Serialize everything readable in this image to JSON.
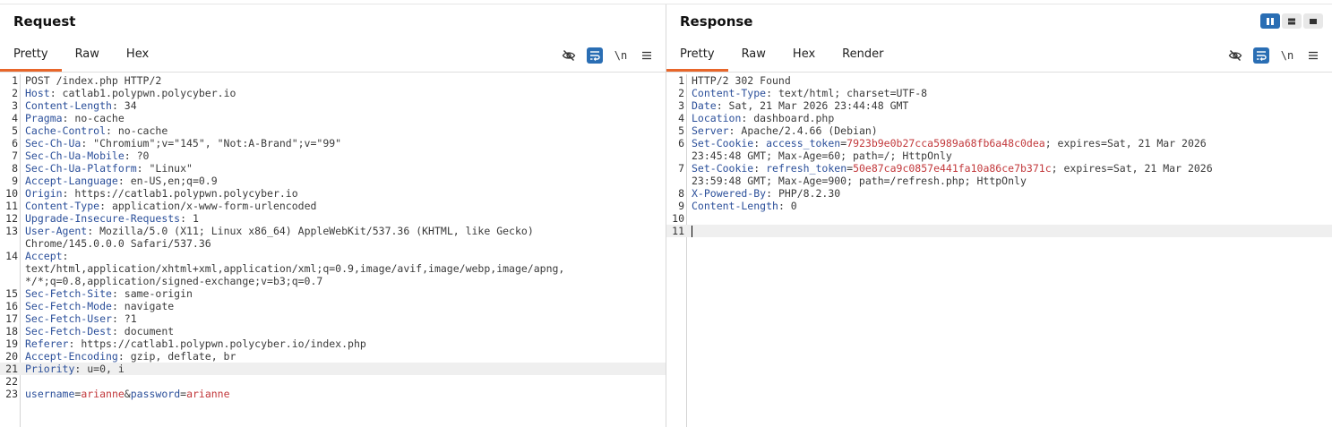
{
  "request": {
    "title": "Request",
    "tabs": [
      "Pretty",
      "Raw",
      "Hex"
    ],
    "active_tab": "Pretty",
    "toolbar": {
      "newline_label": "\\n"
    },
    "lines": [
      {
        "n": "1",
        "t": [
          [
            "v",
            "POST /index.php HTTP/2"
          ]
        ]
      },
      {
        "n": "2",
        "t": [
          [
            "k",
            "Host"
          ],
          [
            "v",
            ": catlab1.polypwn.polycyber.io"
          ]
        ]
      },
      {
        "n": "3",
        "t": [
          [
            "k",
            "Content-Length"
          ],
          [
            "v",
            ": 34"
          ]
        ]
      },
      {
        "n": "4",
        "t": [
          [
            "k",
            "Pragma"
          ],
          [
            "v",
            ": no-cache"
          ]
        ]
      },
      {
        "n": "5",
        "t": [
          [
            "k",
            "Cache-Control"
          ],
          [
            "v",
            ": no-cache"
          ]
        ]
      },
      {
        "n": "6",
        "t": [
          [
            "k",
            "Sec-Ch-Ua"
          ],
          [
            "v",
            ": \"Chromium\";v=\"145\", \"Not:A-Brand\";v=\"99\""
          ]
        ]
      },
      {
        "n": "7",
        "t": [
          [
            "k",
            "Sec-Ch-Ua-Mobile"
          ],
          [
            "v",
            ": ?0"
          ]
        ]
      },
      {
        "n": "8",
        "t": [
          [
            "k",
            "Sec-Ch-Ua-Platform"
          ],
          [
            "v",
            ": \"Linux\""
          ]
        ]
      },
      {
        "n": "9",
        "t": [
          [
            "k",
            "Accept-Language"
          ],
          [
            "v",
            ": en-US,en;q=0.9"
          ]
        ]
      },
      {
        "n": "10",
        "t": [
          [
            "k",
            "Origin"
          ],
          [
            "v",
            ": https://catlab1.polypwn.polycyber.io"
          ]
        ]
      },
      {
        "n": "11",
        "t": [
          [
            "k",
            "Content-Type"
          ],
          [
            "v",
            ": application/x-www-form-urlencoded"
          ]
        ]
      },
      {
        "n": "12",
        "t": [
          [
            "k",
            "Upgrade-Insecure-Requests"
          ],
          [
            "v",
            ": 1"
          ]
        ]
      },
      {
        "n": "13",
        "t": [
          [
            "k",
            "User-Agent"
          ],
          [
            "v",
            ": Mozilla/5.0 (X11; Linux x86_64) AppleWebKit/537.36 (KHTML, like Gecko)\nChrome/145.0.0.0 Safari/537.36"
          ]
        ]
      },
      {
        "n": "14",
        "t": [
          [
            "k",
            "Accept"
          ],
          [
            "v",
            ":\ntext/html,application/xhtml+xml,application/xml;q=0.9,image/avif,image/webp,image/apng,\n*/*;q=0.8,application/signed-exchange;v=b3;q=0.7"
          ]
        ]
      },
      {
        "n": "15",
        "t": [
          [
            "k",
            "Sec-Fetch-Site"
          ],
          [
            "v",
            ": same-origin"
          ]
        ]
      },
      {
        "n": "16",
        "t": [
          [
            "k",
            "Sec-Fetch-Mode"
          ],
          [
            "v",
            ": navigate"
          ]
        ]
      },
      {
        "n": "17",
        "t": [
          [
            "k",
            "Sec-Fetch-User"
          ],
          [
            "v",
            ": ?1"
          ]
        ]
      },
      {
        "n": "18",
        "t": [
          [
            "k",
            "Sec-Fetch-Dest"
          ],
          [
            "v",
            ": document"
          ]
        ]
      },
      {
        "n": "19",
        "t": [
          [
            "k",
            "Referer"
          ],
          [
            "v",
            ": https://catlab1.polypwn.polycyber.io/index.php"
          ]
        ]
      },
      {
        "n": "20",
        "t": [
          [
            "k",
            "Accept-Encoding"
          ],
          [
            "v",
            ": gzip, deflate, br"
          ]
        ]
      },
      {
        "n": "21",
        "t": [
          [
            "k",
            "Priority"
          ],
          [
            "v",
            ": u=0, i"
          ]
        ],
        "hl": true
      },
      {
        "n": "22",
        "t": [
          [
            "v",
            ""
          ]
        ]
      },
      {
        "n": "23",
        "t": [
          [
            "k",
            "username"
          ],
          [
            "v",
            "="
          ],
          [
            "r",
            "arianne"
          ],
          [
            "v",
            "&"
          ],
          [
            "k",
            "password"
          ],
          [
            "v",
            "="
          ],
          [
            "r",
            "arianne"
          ]
        ]
      }
    ]
  },
  "response": {
    "title": "Response",
    "tabs": [
      "Pretty",
      "Raw",
      "Hex",
      "Render"
    ],
    "active_tab": "Pretty",
    "toolbar": {
      "newline_label": "\\n"
    },
    "lines": [
      {
        "n": "1",
        "t": [
          [
            "v",
            "HTTP/2 302 Found"
          ]
        ]
      },
      {
        "n": "2",
        "t": [
          [
            "k",
            "Content-Type"
          ],
          [
            "v",
            ": text/html; charset=UTF-8"
          ]
        ]
      },
      {
        "n": "3",
        "t": [
          [
            "k",
            "Date"
          ],
          [
            "v",
            ": Sat, 21 Mar 2026 23:44:48 GMT"
          ]
        ]
      },
      {
        "n": "4",
        "t": [
          [
            "k",
            "Location"
          ],
          [
            "v",
            ": dashboard.php"
          ]
        ]
      },
      {
        "n": "5",
        "t": [
          [
            "k",
            "Server"
          ],
          [
            "v",
            ": Apache/2.4.66 (Debian)"
          ]
        ]
      },
      {
        "n": "6",
        "t": [
          [
            "k",
            "Set-Cookie"
          ],
          [
            "v",
            ": "
          ],
          [
            "k",
            "access_token"
          ],
          [
            "v",
            "="
          ],
          [
            "r",
            "7923b9e0b27cca5989a68fb6a48c0dea"
          ],
          [
            "v",
            "; expires=Sat, 21 Mar 2026\n23:45:48 GMT; Max-Age=60; path=/; HttpOnly"
          ]
        ]
      },
      {
        "n": "7",
        "t": [
          [
            "k",
            "Set-Cookie"
          ],
          [
            "v",
            ": "
          ],
          [
            "k",
            "refresh_token"
          ],
          [
            "v",
            "="
          ],
          [
            "r",
            "50e87ca9c0857e441fa10a86ce7b371c"
          ],
          [
            "v",
            "; expires=Sat, 21 Mar 2026\n23:59:48 GMT; Max-Age=900; path=/refresh.php; HttpOnly"
          ]
        ]
      },
      {
        "n": "8",
        "t": [
          [
            "k",
            "X-Powered-By"
          ],
          [
            "v",
            ": PHP/8.2.30"
          ]
        ]
      },
      {
        "n": "9",
        "t": [
          [
            "k",
            "Content-Length"
          ],
          [
            "v",
            ": 0"
          ]
        ]
      },
      {
        "n": "10",
        "t": [
          [
            "v",
            ""
          ]
        ]
      },
      {
        "n": "11",
        "t": [
          [
            "v",
            ""
          ]
        ],
        "hl": true,
        "caret": true
      }
    ]
  },
  "colors": {
    "accent": "#e8662a",
    "selected_tool": "#2a6eb4",
    "header_key": "#2b4f9a",
    "param_value": "#c2383b"
  },
  "icons": [
    "hide-nonprintable-icon",
    "wrap-lines-icon",
    "newline-icon",
    "menu-icon",
    "layout-split-icon",
    "layout-horizontal-icon",
    "layout-single-icon"
  ]
}
